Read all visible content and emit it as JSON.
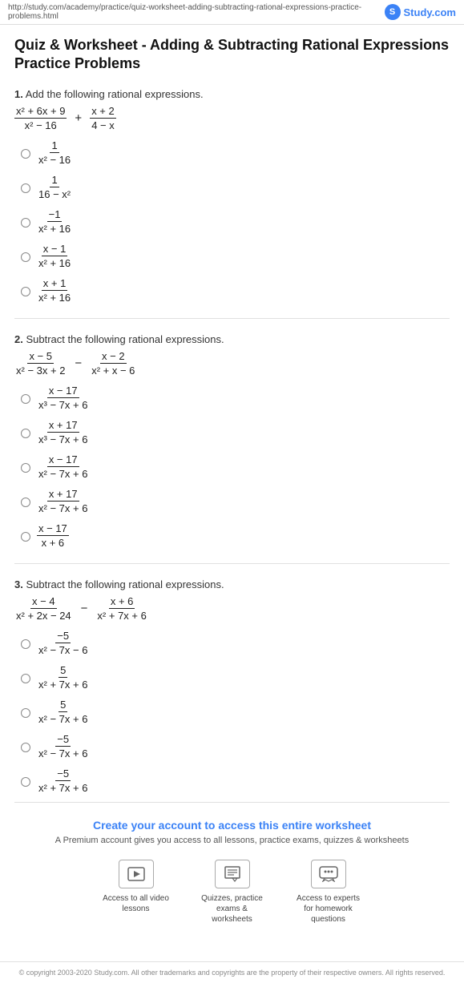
{
  "topbar": {
    "url": "http://study.com/academy/practice/quiz-worksheet-adding-subtracting-rational-expressions-practice-problems.html",
    "logo_text": "Study.com",
    "logo_icon": "S"
  },
  "page": {
    "title": "Quiz & Worksheet - Adding & Subtracting Rational Expressions Practice Problems"
  },
  "questions": [
    {
      "number": "1",
      "label": "Add the following rational expressions.",
      "expression_left_num": "x² + 6x + 9",
      "expression_left_den": "x² − 16",
      "operator": "+",
      "expression_right_num": "x + 2",
      "expression_right_den": "4 − x",
      "options": [
        {
          "num": "1",
          "den": "x² − 16"
        },
        {
          "num": "1",
          "den": "16 − x²"
        },
        {
          "num": "−1",
          "den": "x² + 16"
        },
        {
          "num": "x − 1",
          "den": "x² + 16"
        },
        {
          "num": "x + 1",
          "den": "x² + 16"
        }
      ]
    },
    {
      "number": "2",
      "label": "Subtract the following rational expressions.",
      "expression_left_num": "x − 5",
      "expression_left_den": "x² − 3x + 2",
      "operator": "−",
      "expression_right_num": "x − 2",
      "expression_right_den": "x² + x − 6",
      "options": [
        {
          "num": "x − 17",
          "den": "x³ − 7x + 6"
        },
        {
          "num": "x + 17",
          "den": "x³ − 7x + 6"
        },
        {
          "num": "x − 17",
          "den": "x² − 7x + 6"
        },
        {
          "num": "x + 17",
          "den": "x² − 7x + 6"
        },
        {
          "num": "x − 17",
          "den": "x + 6"
        }
      ]
    },
    {
      "number": "3",
      "label": "Subtract the following rational expressions.",
      "expression_left_num": "x − 4",
      "expression_left_den": "x² + 2x − 24",
      "operator": "−",
      "expression_right_num": "x + 6",
      "expression_right_den": "x² + 7x + 6",
      "options": [
        {
          "num": "−5",
          "den": "x² − 7x − 6"
        },
        {
          "num": "5",
          "den": "x² + 7x + 6"
        },
        {
          "num": "5",
          "den": "x² − 7x + 6"
        },
        {
          "num": "−5",
          "den": "x² − 7x + 6"
        },
        {
          "num": "−5",
          "den": "x² + 7x + 6"
        }
      ]
    }
  ],
  "cta": {
    "title": "Create your account to access this entire worksheet",
    "subtitle": "A Premium account gives you access to all lessons, practice exams, quizzes & worksheets",
    "icons": [
      {
        "icon": "▶",
        "label": "Access to all\nvideo lessons"
      },
      {
        "icon": "📋",
        "label": "Quizzes, practice exams\n& worksheets"
      },
      {
        "icon": "💬",
        "label": "Access to experts for\nhomework questions"
      }
    ]
  },
  "footer": {
    "text": "© copyright 2003-2020 Study.com. All other trademarks and copyrights are the property of their respective owners. All rights reserved."
  }
}
